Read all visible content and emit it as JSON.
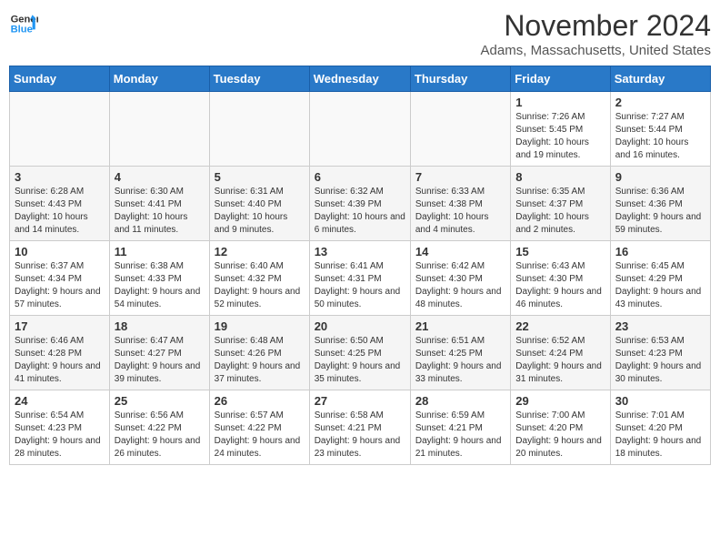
{
  "header": {
    "logo_line1": "General",
    "logo_line2": "Blue",
    "month": "November 2024",
    "location": "Adams, Massachusetts, United States"
  },
  "days_of_week": [
    "Sunday",
    "Monday",
    "Tuesday",
    "Wednesday",
    "Thursday",
    "Friday",
    "Saturday"
  ],
  "weeks": [
    [
      {
        "day": "",
        "sunrise": "",
        "sunset": "",
        "daylight": ""
      },
      {
        "day": "",
        "sunrise": "",
        "sunset": "",
        "daylight": ""
      },
      {
        "day": "",
        "sunrise": "",
        "sunset": "",
        "daylight": ""
      },
      {
        "day": "",
        "sunrise": "",
        "sunset": "",
        "daylight": ""
      },
      {
        "day": "",
        "sunrise": "",
        "sunset": "",
        "daylight": ""
      },
      {
        "day": "1",
        "sunrise": "Sunrise: 7:26 AM",
        "sunset": "Sunset: 5:45 PM",
        "daylight": "Daylight: 10 hours and 19 minutes."
      },
      {
        "day": "2",
        "sunrise": "Sunrise: 7:27 AM",
        "sunset": "Sunset: 5:44 PM",
        "daylight": "Daylight: 10 hours and 16 minutes."
      }
    ],
    [
      {
        "day": "3",
        "sunrise": "Sunrise: 6:28 AM",
        "sunset": "Sunset: 4:43 PM",
        "daylight": "Daylight: 10 hours and 14 minutes."
      },
      {
        "day": "4",
        "sunrise": "Sunrise: 6:30 AM",
        "sunset": "Sunset: 4:41 PM",
        "daylight": "Daylight: 10 hours and 11 minutes."
      },
      {
        "day": "5",
        "sunrise": "Sunrise: 6:31 AM",
        "sunset": "Sunset: 4:40 PM",
        "daylight": "Daylight: 10 hours and 9 minutes."
      },
      {
        "day": "6",
        "sunrise": "Sunrise: 6:32 AM",
        "sunset": "Sunset: 4:39 PM",
        "daylight": "Daylight: 10 hours and 6 minutes."
      },
      {
        "day": "7",
        "sunrise": "Sunrise: 6:33 AM",
        "sunset": "Sunset: 4:38 PM",
        "daylight": "Daylight: 10 hours and 4 minutes."
      },
      {
        "day": "8",
        "sunrise": "Sunrise: 6:35 AM",
        "sunset": "Sunset: 4:37 PM",
        "daylight": "Daylight: 10 hours and 2 minutes."
      },
      {
        "day": "9",
        "sunrise": "Sunrise: 6:36 AM",
        "sunset": "Sunset: 4:36 PM",
        "daylight": "Daylight: 9 hours and 59 minutes."
      }
    ],
    [
      {
        "day": "10",
        "sunrise": "Sunrise: 6:37 AM",
        "sunset": "Sunset: 4:34 PM",
        "daylight": "Daylight: 9 hours and 57 minutes."
      },
      {
        "day": "11",
        "sunrise": "Sunrise: 6:38 AM",
        "sunset": "Sunset: 4:33 PM",
        "daylight": "Daylight: 9 hours and 54 minutes."
      },
      {
        "day": "12",
        "sunrise": "Sunrise: 6:40 AM",
        "sunset": "Sunset: 4:32 PM",
        "daylight": "Daylight: 9 hours and 52 minutes."
      },
      {
        "day": "13",
        "sunrise": "Sunrise: 6:41 AM",
        "sunset": "Sunset: 4:31 PM",
        "daylight": "Daylight: 9 hours and 50 minutes."
      },
      {
        "day": "14",
        "sunrise": "Sunrise: 6:42 AM",
        "sunset": "Sunset: 4:30 PM",
        "daylight": "Daylight: 9 hours and 48 minutes."
      },
      {
        "day": "15",
        "sunrise": "Sunrise: 6:43 AM",
        "sunset": "Sunset: 4:30 PM",
        "daylight": "Daylight: 9 hours and 46 minutes."
      },
      {
        "day": "16",
        "sunrise": "Sunrise: 6:45 AM",
        "sunset": "Sunset: 4:29 PM",
        "daylight": "Daylight: 9 hours and 43 minutes."
      }
    ],
    [
      {
        "day": "17",
        "sunrise": "Sunrise: 6:46 AM",
        "sunset": "Sunset: 4:28 PM",
        "daylight": "Daylight: 9 hours and 41 minutes."
      },
      {
        "day": "18",
        "sunrise": "Sunrise: 6:47 AM",
        "sunset": "Sunset: 4:27 PM",
        "daylight": "Daylight: 9 hours and 39 minutes."
      },
      {
        "day": "19",
        "sunrise": "Sunrise: 6:48 AM",
        "sunset": "Sunset: 4:26 PM",
        "daylight": "Daylight: 9 hours and 37 minutes."
      },
      {
        "day": "20",
        "sunrise": "Sunrise: 6:50 AM",
        "sunset": "Sunset: 4:25 PM",
        "daylight": "Daylight: 9 hours and 35 minutes."
      },
      {
        "day": "21",
        "sunrise": "Sunrise: 6:51 AM",
        "sunset": "Sunset: 4:25 PM",
        "daylight": "Daylight: 9 hours and 33 minutes."
      },
      {
        "day": "22",
        "sunrise": "Sunrise: 6:52 AM",
        "sunset": "Sunset: 4:24 PM",
        "daylight": "Daylight: 9 hours and 31 minutes."
      },
      {
        "day": "23",
        "sunrise": "Sunrise: 6:53 AM",
        "sunset": "Sunset: 4:23 PM",
        "daylight": "Daylight: 9 hours and 30 minutes."
      }
    ],
    [
      {
        "day": "24",
        "sunrise": "Sunrise: 6:54 AM",
        "sunset": "Sunset: 4:23 PM",
        "daylight": "Daylight: 9 hours and 28 minutes."
      },
      {
        "day": "25",
        "sunrise": "Sunrise: 6:56 AM",
        "sunset": "Sunset: 4:22 PM",
        "daylight": "Daylight: 9 hours and 26 minutes."
      },
      {
        "day": "26",
        "sunrise": "Sunrise: 6:57 AM",
        "sunset": "Sunset: 4:22 PM",
        "daylight": "Daylight: 9 hours and 24 minutes."
      },
      {
        "day": "27",
        "sunrise": "Sunrise: 6:58 AM",
        "sunset": "Sunset: 4:21 PM",
        "daylight": "Daylight: 9 hours and 23 minutes."
      },
      {
        "day": "28",
        "sunrise": "Sunrise: 6:59 AM",
        "sunset": "Sunset: 4:21 PM",
        "daylight": "Daylight: 9 hours and 21 minutes."
      },
      {
        "day": "29",
        "sunrise": "Sunrise: 7:00 AM",
        "sunset": "Sunset: 4:20 PM",
        "daylight": "Daylight: 9 hours and 20 minutes."
      },
      {
        "day": "30",
        "sunrise": "Sunrise: 7:01 AM",
        "sunset": "Sunset: 4:20 PM",
        "daylight": "Daylight: 9 hours and 18 minutes."
      }
    ]
  ]
}
